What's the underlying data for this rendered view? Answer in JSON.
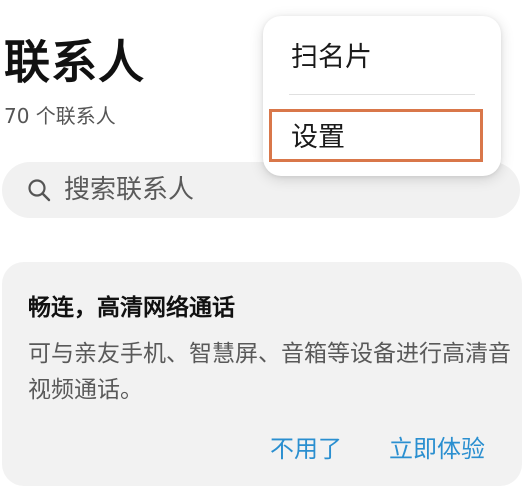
{
  "header": {
    "title": "联系人",
    "count_text": "70 个联系人"
  },
  "search": {
    "icon": "search-icon",
    "placeholder": "搜索联系人"
  },
  "promo": {
    "title": "畅连，高清网络通话",
    "description": "可与亲友手机、智慧屏、音箱等设备进行高清音视频通话。",
    "dismiss_label": "不用了",
    "try_label": "立即体验"
  },
  "menu": {
    "items": [
      {
        "label": "扫名片"
      },
      {
        "label": "设置"
      }
    ],
    "highlighted_item": "设置"
  },
  "colors": {
    "accent": "#2a8fd0",
    "highlight": "#d9774a",
    "card_background": "#f2f2f2",
    "search_background": "#f1f1f1"
  }
}
